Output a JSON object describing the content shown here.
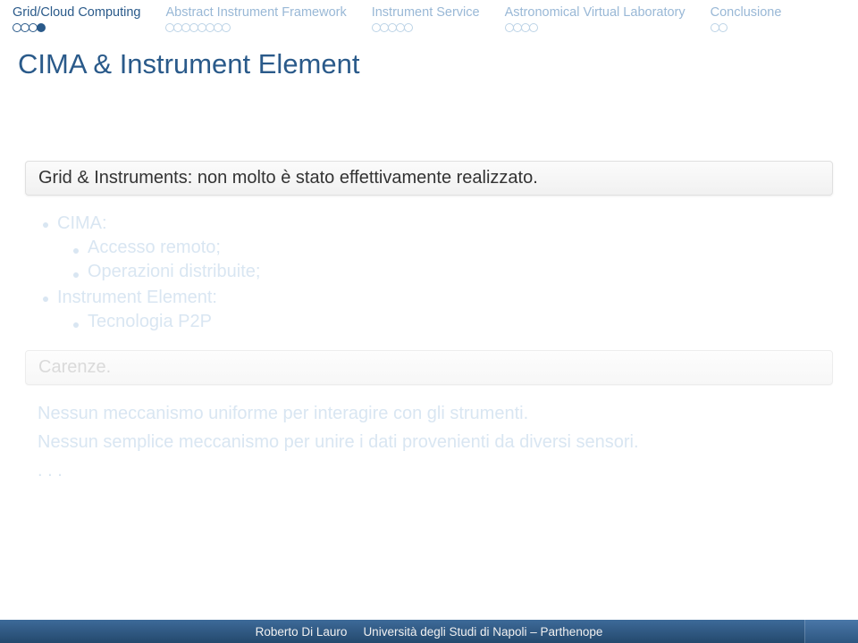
{
  "nav": [
    {
      "label": "Grid/Cloud Computing",
      "active": true,
      "total": 4,
      "current": 4
    },
    {
      "label": "Abstract Instrument Framework",
      "active": false,
      "total": 8,
      "current": 0
    },
    {
      "label": "Instrument Service",
      "active": false,
      "total": 5,
      "current": 0
    },
    {
      "label": "Astronomical Virtual Laboratory",
      "active": false,
      "total": 4,
      "current": 0
    },
    {
      "label": "Conclusione",
      "active": false,
      "total": 2,
      "current": 0
    }
  ],
  "title": "CIMA & Instrument Element",
  "block1_title": "Grid & Instruments: non molto è stato effettivamente realizzato.",
  "faded_list": {
    "item1": "CIMA:",
    "item1a": "Accesso remoto;",
    "item1b": "Operazioni distribuite;",
    "item2": "Instrument Element:",
    "item2a": "Tecnologia P2P"
  },
  "block2_title": "Carenze.",
  "block2_body1": "Nessun meccanismo uniforme per interagire con gli strumenti.",
  "block2_body2": "Nessun semplice meccanismo per unire i dati provenienti da diversi sensori.",
  "block2_body3": ". . .",
  "footer": {
    "author": "Roberto Di Lauro",
    "institution": "Università degli Studi di Napoli – Parthenope"
  }
}
